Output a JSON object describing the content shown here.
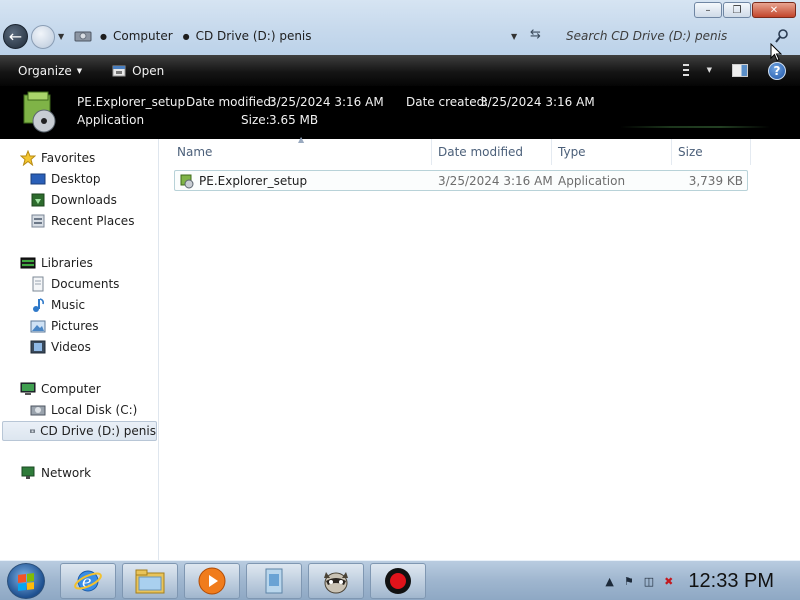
{
  "window": {
    "controls": {
      "minimize": "–",
      "maximize": "❐",
      "close": "✕"
    }
  },
  "address_bar": {
    "breadcrumbs": [
      {
        "label": "Computer"
      },
      {
        "label": "CD Drive (D:) penis"
      }
    ]
  },
  "search": {
    "placeholder": "Search CD Drive (D:) penis"
  },
  "command_bar": {
    "organize_label": "Organize",
    "open_label": "Open",
    "help_label": "?"
  },
  "details_pane": {
    "file_name": "PE.Explorer_setup",
    "file_type": "Application",
    "date_modified_label": "Date modified:",
    "date_modified": "3/25/2024 3:16 AM",
    "date_created_label": "Date created:",
    "date_created": "3/25/2024 3:16 AM",
    "size_label": "Size:",
    "size": "3.65 MB"
  },
  "navigation": {
    "favorites": {
      "label": "Favorites",
      "items": [
        {
          "label": "Desktop"
        },
        {
          "label": "Downloads"
        },
        {
          "label": "Recent Places"
        }
      ]
    },
    "libraries": {
      "label": "Libraries",
      "items": [
        {
          "label": "Documents"
        },
        {
          "label": "Music"
        },
        {
          "label": "Pictures"
        },
        {
          "label": "Videos"
        }
      ]
    },
    "computer": {
      "label": "Computer",
      "items": [
        {
          "label": "Local Disk (C:)"
        },
        {
          "label": "CD Drive (D:) penis",
          "selected": true
        }
      ]
    },
    "network": {
      "label": "Network"
    }
  },
  "file_list": {
    "columns": [
      "Name",
      "Date modified",
      "Type",
      "Size"
    ],
    "rows": [
      {
        "name": "PE.Explorer_setup",
        "date_modified": "3/25/2024 3:16 AM",
        "type": "Application",
        "size": "3,739 KB"
      }
    ]
  },
  "taskbar": {
    "pinned": [
      "internet-explorer",
      "windows-explorer",
      "media-player",
      "application-installer",
      "raccoon-app",
      "record-app"
    ],
    "clock": "12:33 PM"
  },
  "colors": {
    "command_bar": "#111111",
    "details_pane": "#000000",
    "selection_border": "#b8d2d8",
    "column_header_text": "#4c607a",
    "taskbar": "#a9bfd6"
  }
}
